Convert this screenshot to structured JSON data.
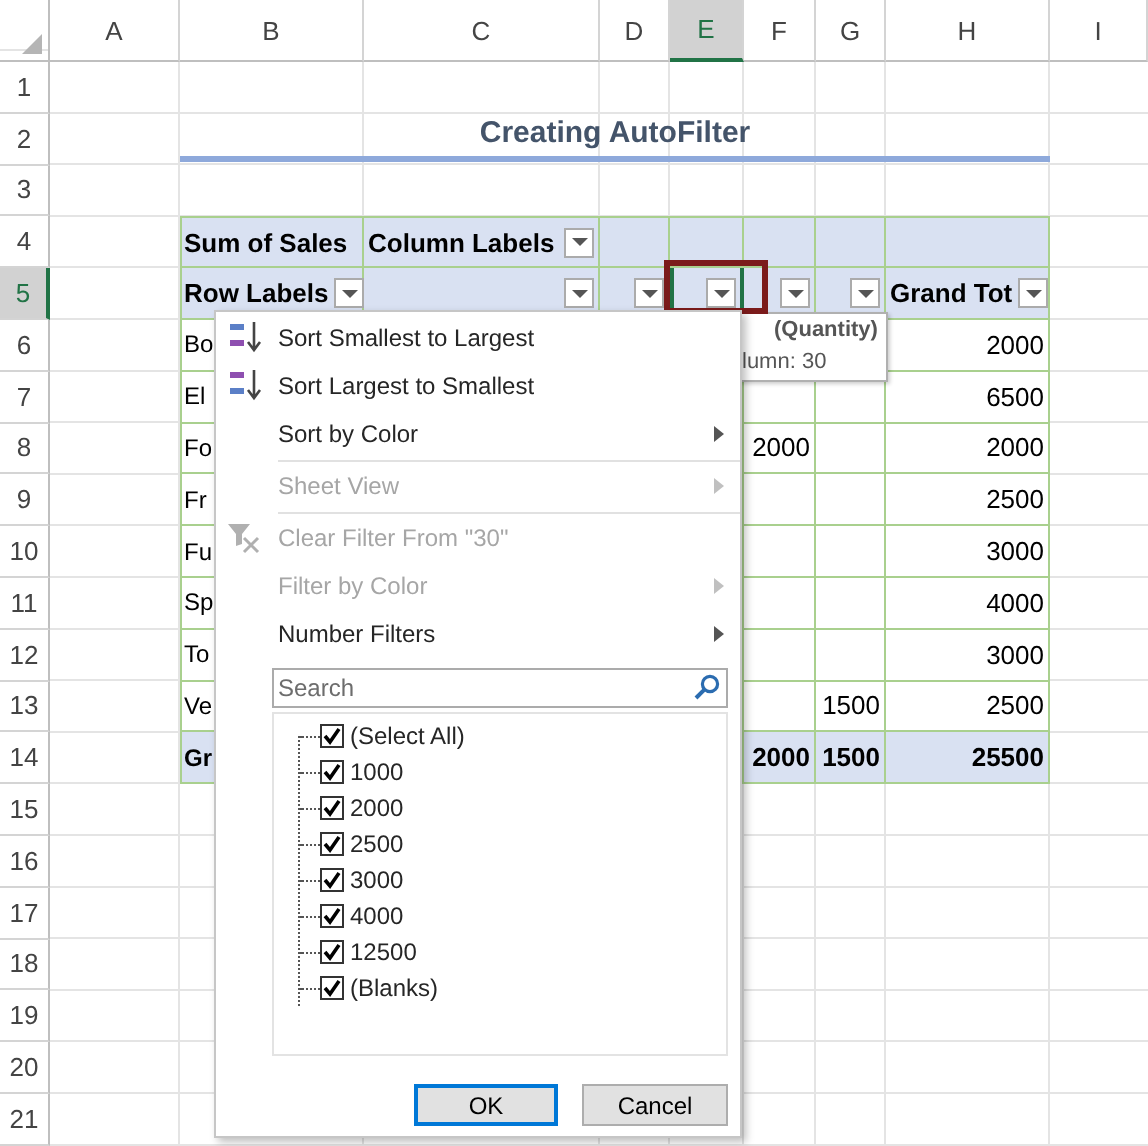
{
  "sheet": {
    "columns": [
      {
        "label": "A",
        "selected": false
      },
      {
        "label": "B",
        "selected": false
      },
      {
        "label": "C",
        "selected": false
      },
      {
        "label": "D",
        "selected": false
      },
      {
        "label": "E",
        "selected": true
      },
      {
        "label": "F",
        "selected": false
      },
      {
        "label": "G",
        "selected": false
      },
      {
        "label": "H",
        "selected": false
      },
      {
        "label": "I",
        "selected": false
      }
    ],
    "rows": [
      {
        "label": "1",
        "selected": false
      },
      {
        "label": "2",
        "selected": false
      },
      {
        "label": "3",
        "selected": false
      },
      {
        "label": "4",
        "selected": false
      },
      {
        "label": "5",
        "selected": true
      },
      {
        "label": "6",
        "selected": false
      },
      {
        "label": "7",
        "selected": false
      },
      {
        "label": "8",
        "selected": false
      },
      {
        "label": "9",
        "selected": false
      },
      {
        "label": "10",
        "selected": false
      },
      {
        "label": "11",
        "selected": false
      },
      {
        "label": "12",
        "selected": false
      },
      {
        "label": "13",
        "selected": false
      },
      {
        "label": "14",
        "selected": false
      },
      {
        "label": "15",
        "selected": false
      },
      {
        "label": "16",
        "selected": false
      },
      {
        "label": "17",
        "selected": false
      },
      {
        "label": "18",
        "selected": false
      },
      {
        "label": "19",
        "selected": false
      },
      {
        "label": "20",
        "selected": false
      },
      {
        "label": "21",
        "selected": false
      }
    ],
    "title": "Creating AutoFilter",
    "pivot": [
      {
        "kind": "header",
        "cells": [
          {
            "text": "Sum of Sales",
            "dropdown": false
          },
          {
            "text": "Column Labels",
            "dropdown": true
          },
          null,
          null,
          null,
          null,
          null
        ]
      },
      {
        "kind": "header",
        "cells": [
          {
            "text": "Row Labels",
            "dropdown": true
          },
          {
            "dropdown": true
          },
          {
            "dropdown": true
          },
          {
            "dropdown": true,
            "highlighted": true
          },
          {
            "dropdown": true
          },
          {
            "dropdown": true
          },
          {
            "text": "Grand Tot",
            "dropdown": true
          }
        ]
      },
      {
        "kind": "data",
        "cells": [
          {
            "text": "Bo"
          },
          null,
          null,
          null,
          null,
          null,
          {
            "text": "2000"
          }
        ]
      },
      {
        "kind": "data",
        "cells": [
          {
            "text": "El"
          },
          null,
          null,
          null,
          null,
          null,
          {
            "text": "6500"
          }
        ]
      },
      {
        "kind": "data",
        "cells": [
          {
            "text": "Fo"
          },
          null,
          null,
          null,
          {
            "text": "2000"
          },
          null,
          {
            "text": "2000"
          }
        ]
      },
      {
        "kind": "data",
        "cells": [
          {
            "text": "Fr"
          },
          null,
          null,
          null,
          null,
          null,
          {
            "text": "2500"
          }
        ]
      },
      {
        "kind": "data",
        "cells": [
          {
            "text": "Fu"
          },
          null,
          null,
          null,
          null,
          null,
          {
            "text": "3000"
          }
        ]
      },
      {
        "kind": "data",
        "cells": [
          {
            "text": "Sp"
          },
          null,
          null,
          null,
          null,
          null,
          {
            "text": "4000"
          }
        ]
      },
      {
        "kind": "data",
        "cells": [
          {
            "text": "To"
          },
          null,
          null,
          null,
          null,
          null,
          {
            "text": "3000"
          }
        ]
      },
      {
        "kind": "data",
        "cells": [
          {
            "text": "Ve"
          },
          null,
          null,
          null,
          null,
          {
            "text": "1500"
          },
          {
            "text": "2500"
          }
        ]
      },
      {
        "kind": "total",
        "cells": [
          {
            "text": "Gr"
          },
          null,
          null,
          null,
          {
            "text": "2000"
          },
          {
            "text": "1500"
          },
          {
            "text": "25500"
          }
        ]
      }
    ]
  },
  "tooltip": {
    "lines": [
      "(Quantity)",
      "lumn: 30"
    ]
  },
  "filter_menu": {
    "items": [
      {
        "kind": "ascending",
        "label": "Sort Smallest to Largest",
        "disabled": false,
        "submenu": false
      },
      {
        "kind": "descending",
        "label": "Sort Largest to Smallest",
        "disabled": false,
        "submenu": false
      },
      {
        "kind": "item",
        "label": "Sort by Color",
        "disabled": false,
        "submenu": true
      },
      {
        "kind": "separator"
      },
      {
        "kind": "item",
        "label": "Sheet View",
        "disabled": true,
        "submenu": true
      },
      {
        "kind": "separator"
      },
      {
        "kind": "clear",
        "label": "Clear Filter From \"30\"",
        "disabled": true,
        "submenu": false
      },
      {
        "kind": "item",
        "label": "Filter by Color",
        "disabled": true,
        "submenu": true
      },
      {
        "kind": "item",
        "label": "Number Filters",
        "disabled": false,
        "submenu": true
      }
    ],
    "search": {
      "placeholder": "Search"
    },
    "values": [
      {
        "label": "(Select All)",
        "checked": true
      },
      {
        "label": "1000",
        "checked": true
      },
      {
        "label": "2000",
        "checked": true
      },
      {
        "label": "2500",
        "checked": true
      },
      {
        "label": "3000",
        "checked": true
      },
      {
        "label": "4000",
        "checked": true
      },
      {
        "label": "12500",
        "checked": true
      },
      {
        "label": "(Blanks)",
        "checked": true
      }
    ],
    "buttons": [
      {
        "label": "OK",
        "selected": true
      },
      {
        "label": "Cancel",
        "selected": false
      }
    ]
  }
}
